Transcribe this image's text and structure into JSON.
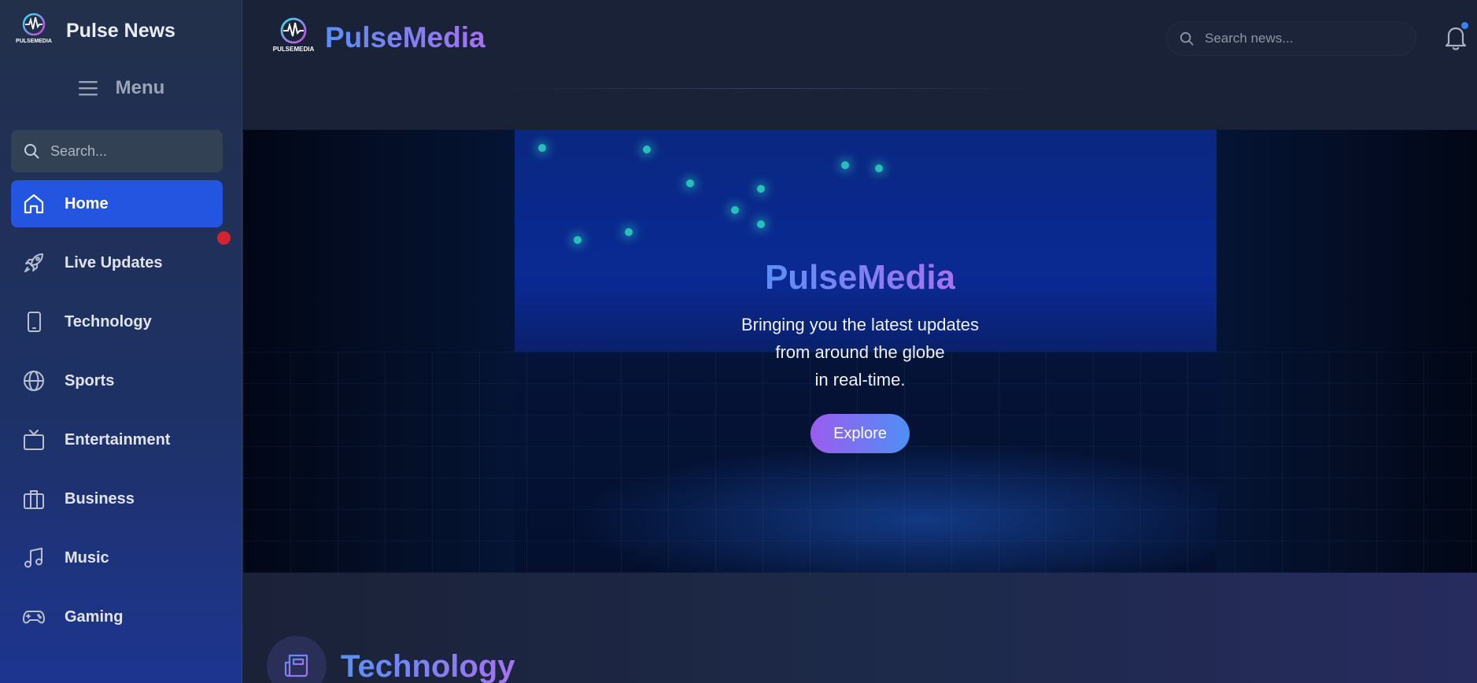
{
  "sidebar": {
    "brand_name": "Pulse News",
    "logo_text": "PULSEMEDIA",
    "menu_label": "Menu",
    "search_placeholder": "Search...",
    "items": [
      {
        "label": "Home",
        "icon": "home-icon",
        "active": true
      },
      {
        "label": "Live Updates",
        "icon": "rocket-icon",
        "badge": "red-dot"
      },
      {
        "label": "Technology",
        "icon": "tablet-icon"
      },
      {
        "label": "Sports",
        "icon": "globe-icon"
      },
      {
        "label": "Entertainment",
        "icon": "tv-icon"
      },
      {
        "label": "Business",
        "icon": "briefcase-icon"
      },
      {
        "label": "Music",
        "icon": "music-note-icon"
      },
      {
        "label": "Gaming",
        "icon": "gamepad-icon"
      }
    ]
  },
  "header": {
    "title": "PulseMedia",
    "search_placeholder": "Search news...",
    "notification_icon": "bell-icon"
  },
  "hero": {
    "title": "PulseMedia",
    "subtitle_lines": [
      "Bringing you the latest updates",
      "from around the globe",
      "in real-time."
    ],
    "button_label": "Explore"
  },
  "section": {
    "title": "Technology",
    "icon": "newspaper-icon"
  },
  "colors": {
    "accent_blue": "#2455e0",
    "gradient_start": "#5b8ff5",
    "gradient_end": "#a672ef",
    "live_badge": "#d3242f",
    "notification_dot": "#3b82f6"
  }
}
